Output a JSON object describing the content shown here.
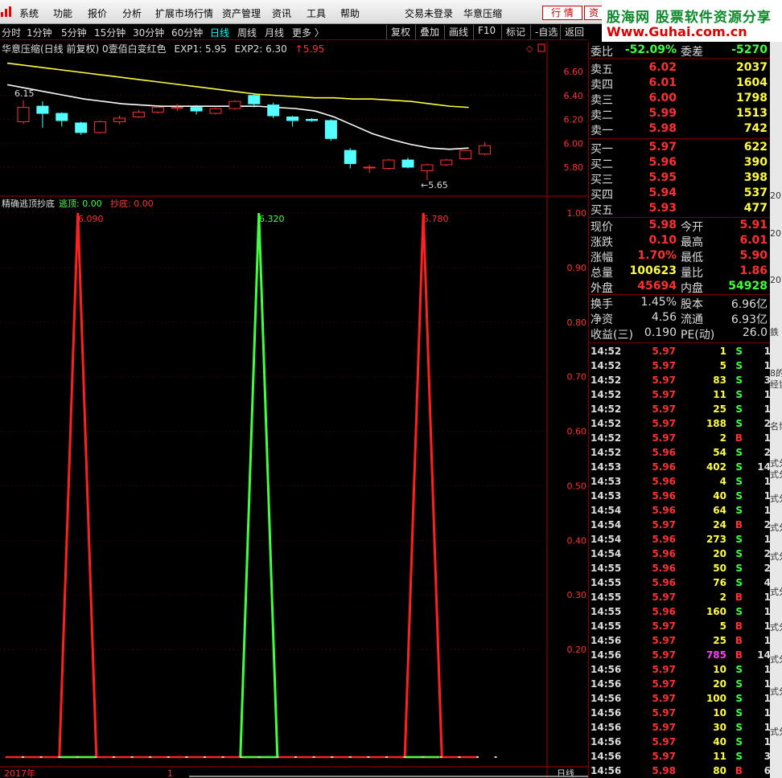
{
  "menubar": {
    "items": [
      "系统",
      "功能",
      "报价",
      "分析",
      "扩展市场行情",
      "资产管理",
      "资讯",
      "工具",
      "帮助"
    ],
    "login_status": "交易未登录",
    "app_name": "华意压缩",
    "btn_quote": "行 情",
    "btn_info": "资",
    "brand_line1": "股海网 股票软件资源分享",
    "brand_line2": "Www.Guhai.com.cn"
  },
  "toolbar": {
    "periods": [
      "分时",
      "1分钟",
      "5分钟",
      "15分钟",
      "30分钟",
      "60分钟",
      "日线",
      "周线",
      "月线",
      "更多 〉"
    ],
    "active_period": "日线",
    "actions": [
      "复权",
      "叠加",
      "画线",
      "F10",
      "标记",
      "-自选",
      "返回"
    ]
  },
  "price_panel": {
    "title": "华意压缩(日线 前复权)",
    "indicator": "0壹佰白变红色",
    "exp1": "EXP1: 5.95",
    "exp2": "EXP2: 6.30",
    "last_change": "↑5.95",
    "low_marker": "←5.65",
    "left_marker": "6.15",
    "y_ticks": [
      "6.60",
      "6.40",
      "6.20",
      "6.00",
      "5.80"
    ],
    "colors": {
      "up": "#ff3030",
      "down": "#54ffff",
      "ma1": "#ffffff",
      "ma2": "#ffff40"
    }
  },
  "indicator_panel": {
    "title": "精确逃顶抄底",
    "escape_label": "逃顶: 0.00",
    "bottom_label": "抄底: 0.00",
    "y_ticks": [
      "1.00",
      "0.90",
      "0.80",
      "0.70",
      "0.60",
      "0.50",
      "0.40",
      "0.30",
      "0.20"
    ],
    "peak_labels": [
      "6.090",
      "6.320",
      "5.780"
    ],
    "x_label": "2017年",
    "x_label2": "1",
    "period_label": "日线"
  },
  "chart_data": [
    {
      "type": "candlestick",
      "title": "华意压缩(日线 前复权)",
      "ylim": [
        5.6,
        6.7
      ],
      "candles": [
        {
          "o": 6.18,
          "c": 6.3,
          "h": 6.36,
          "l": 6.16
        },
        {
          "o": 6.31,
          "c": 6.25,
          "h": 6.35,
          "l": 6.13
        },
        {
          "o": 6.25,
          "c": 6.19,
          "h": 6.26,
          "l": 6.14
        },
        {
          "o": 6.17,
          "c": 6.09,
          "h": 6.18,
          "l": 6.07
        },
        {
          "o": 6.09,
          "c": 6.18,
          "h": 6.19,
          "l": 6.08
        },
        {
          "o": 6.18,
          "c": 6.21,
          "h": 6.23,
          "l": 6.16
        },
        {
          "o": 6.22,
          "c": 6.26,
          "h": 6.28,
          "l": 6.21
        },
        {
          "o": 6.26,
          "c": 6.3,
          "h": 6.31,
          "l": 6.25
        },
        {
          "o": 6.3,
          "c": 6.3,
          "h": 6.33,
          "l": 6.27
        },
        {
          "o": 6.3,
          "c": 6.27,
          "h": 6.32,
          "l": 6.24
        },
        {
          "o": 6.25,
          "c": 6.29,
          "h": 6.3,
          "l": 6.24
        },
        {
          "o": 6.29,
          "c": 6.35,
          "h": 6.36,
          "l": 6.28
        },
        {
          "o": 6.4,
          "c": 6.33,
          "h": 6.41,
          "l": 6.3
        },
        {
          "o": 6.32,
          "c": 6.23,
          "h": 6.34,
          "l": 6.21
        },
        {
          "o": 6.22,
          "c": 6.19,
          "h": 6.23,
          "l": 6.14
        },
        {
          "o": 6.2,
          "c": 6.19,
          "h": 6.21,
          "l": 6.18
        },
        {
          "o": 6.19,
          "c": 6.04,
          "h": 6.2,
          "l": 6.02
        },
        {
          "o": 5.94,
          "c": 5.83,
          "h": 5.96,
          "l": 5.79
        },
        {
          "o": 5.8,
          "c": 5.8,
          "h": 5.82,
          "l": 5.75
        },
        {
          "o": 5.79,
          "c": 5.86,
          "h": 5.87,
          "l": 5.78
        },
        {
          "o": 5.86,
          "c": 5.8,
          "h": 5.88,
          "l": 5.79
        },
        {
          "o": 5.77,
          "c": 5.82,
          "h": 5.83,
          "l": 5.69
        },
        {
          "o": 5.82,
          "c": 5.86,
          "h": 5.87,
          "l": 5.81
        },
        {
          "o": 5.87,
          "c": 5.94,
          "h": 5.94,
          "l": 5.86
        },
        {
          "o": 5.91,
          "c": 5.98,
          "h": 6.01,
          "l": 5.9
        }
      ],
      "ma_white": [
        6.49,
        6.46,
        6.43,
        6.4,
        6.37,
        6.35,
        6.33,
        6.32,
        6.31,
        6.31,
        6.31,
        6.31,
        6.31,
        6.31,
        6.3,
        6.29,
        6.27,
        6.22,
        6.15,
        6.08,
        6.03,
        5.99,
        5.96,
        5.95,
        5.96
      ],
      "ma_yellow": [
        6.67,
        6.65,
        6.63,
        6.61,
        6.59,
        6.57,
        6.55,
        6.53,
        6.51,
        6.49,
        6.47,
        6.45,
        6.43,
        6.41,
        6.4,
        6.39,
        6.38,
        6.38,
        6.37,
        6.37,
        6.36,
        6.35,
        6.33,
        6.31,
        6.3
      ]
    },
    {
      "type": "line",
      "title": "精确逃顶抄底",
      "ylim": [
        0,
        1.0
      ],
      "series": [
        {
          "name": "逃顶",
          "color": "#40ff40",
          "values": [
            0,
            0,
            0,
            0,
            0,
            0,
            0,
            0,
            0,
            0,
            0,
            0,
            0,
            1,
            0,
            0,
            0,
            0,
            0,
            0,
            0,
            0,
            0,
            0,
            0,
            0,
            0
          ]
        },
        {
          "name": "抄底",
          "color": "#ff2020",
          "values": [
            0,
            0,
            0,
            1,
            0,
            0,
            0,
            0,
            0,
            0,
            0,
            0,
            0,
            0,
            0,
            0,
            0,
            0,
            0,
            0,
            0,
            0,
            1,
            0,
            0,
            0,
            0
          ]
        }
      ]
    }
  ],
  "quote": {
    "weibi": {
      "label": "委比",
      "value": "-52.09%",
      "label2": "委差",
      "value2": "-5270"
    },
    "asks": [
      {
        "label": "卖五",
        "price": "6.02",
        "vol": "2037"
      },
      {
        "label": "卖四",
        "price": "6.01",
        "vol": "1604"
      },
      {
        "label": "卖三",
        "price": "6.00",
        "vol": "1798"
      },
      {
        "label": "卖二",
        "price": "5.99",
        "vol": "1513"
      },
      {
        "label": "卖一",
        "price": "5.98",
        "vol": "742"
      }
    ],
    "bids": [
      {
        "label": "买一",
        "price": "5.97",
        "vol": "622"
      },
      {
        "label": "买二",
        "price": "5.96",
        "vol": "390"
      },
      {
        "label": "买三",
        "price": "5.95",
        "vol": "398"
      },
      {
        "label": "买四",
        "price": "5.94",
        "vol": "537"
      },
      {
        "label": "买五",
        "price": "5.93",
        "vol": "477"
      }
    ],
    "stats": [
      {
        "l1": "现价",
        "v1": "5.98",
        "c1": "#ff3030",
        "l2": "今开",
        "v2": "5.91",
        "c2": "#ff3030"
      },
      {
        "l1": "涨跌",
        "v1": "0.10",
        "c1": "#ff3030",
        "l2": "最高",
        "v2": "6.01",
        "c2": "#ff3030"
      },
      {
        "l1": "涨幅",
        "v1": "1.70%",
        "c1": "#ff3030",
        "l2": "最低",
        "v2": "5.90",
        "c2": "#ff3030"
      },
      {
        "l1": "总量",
        "v1": "100623",
        "c1": "#ffff40",
        "l2": "量比",
        "v2": "1.86",
        "c2": "#ff3030"
      },
      {
        "l1": "外盘",
        "v1": "45694",
        "c1": "#ff3030",
        "l2": "内盘",
        "v2": "54928",
        "c2": "#40ff40"
      }
    ],
    "stats2": [
      {
        "l1": "换手",
        "v1": "1.45%",
        "l2": "股本",
        "v2": "6.96亿"
      },
      {
        "l1": "净资",
        "v1": "4.56",
        "l2": "流通",
        "v2": "6.93亿"
      },
      {
        "l1": "收益(三)",
        "v1": "0.190",
        "l2": "PE(动)",
        "v2": "26.0"
      }
    ],
    "ticks": [
      {
        "t": "14:52",
        "p": "5.97",
        "v": "1",
        "bs": "S",
        "n": "1"
      },
      {
        "t": "14:52",
        "p": "5.97",
        "v": "5",
        "bs": "S",
        "n": "1"
      },
      {
        "t": "14:52",
        "p": "5.97",
        "v": "83",
        "bs": "S",
        "n": "3"
      },
      {
        "t": "14:52",
        "p": "5.97",
        "v": "11",
        "bs": "S",
        "n": "1"
      },
      {
        "t": "14:52",
        "p": "5.97",
        "v": "25",
        "bs": "S",
        "n": "1"
      },
      {
        "t": "14:52",
        "p": "5.97",
        "v": "188",
        "bs": "S",
        "n": "2"
      },
      {
        "t": "14:52",
        "p": "5.97",
        "v": "2",
        "bs": "B",
        "n": "1"
      },
      {
        "t": "14:52",
        "p": "5.96",
        "v": "54",
        "bs": "S",
        "n": "2"
      },
      {
        "t": "14:53",
        "p": "5.96",
        "v": "402",
        "bs": "S",
        "n": "14"
      },
      {
        "t": "14:53",
        "p": "5.96",
        "v": "4",
        "bs": "S",
        "n": "1"
      },
      {
        "t": "14:53",
        "p": "5.96",
        "v": "40",
        "bs": "S",
        "n": "1"
      },
      {
        "t": "14:54",
        "p": "5.96",
        "v": "64",
        "bs": "S",
        "n": "1"
      },
      {
        "t": "14:54",
        "p": "5.97",
        "v": "24",
        "bs": "B",
        "n": "2"
      },
      {
        "t": "14:54",
        "p": "5.96",
        "v": "273",
        "bs": "S",
        "n": "1"
      },
      {
        "t": "14:54",
        "p": "5.96",
        "v": "20",
        "bs": "S",
        "n": "2"
      },
      {
        "t": "14:55",
        "p": "5.96",
        "v": "50",
        "bs": "S",
        "n": "2"
      },
      {
        "t": "14:55",
        "p": "5.96",
        "v": "76",
        "bs": "S",
        "n": "4"
      },
      {
        "t": "14:55",
        "p": "5.97",
        "v": "2",
        "bs": "B",
        "n": "1"
      },
      {
        "t": "14:55",
        "p": "5.96",
        "v": "160",
        "bs": "S",
        "n": "1"
      },
      {
        "t": "14:55",
        "p": "5.97",
        "v": "5",
        "bs": "B",
        "n": "1"
      },
      {
        "t": "14:56",
        "p": "5.97",
        "v": "25",
        "bs": "B",
        "n": "1"
      },
      {
        "t": "14:56",
        "p": "5.97",
        "v": "785",
        "bs": "B",
        "n": "14"
      },
      {
        "t": "14:56",
        "p": "5.97",
        "v": "10",
        "bs": "S",
        "n": "1"
      },
      {
        "t": "14:56",
        "p": "5.97",
        "v": "20",
        "bs": "S",
        "n": "1"
      },
      {
        "t": "14:56",
        "p": "5.97",
        "v": "100",
        "bs": "S",
        "n": "1"
      },
      {
        "t": "14:56",
        "p": "5.97",
        "v": "10",
        "bs": "S",
        "n": "1"
      },
      {
        "t": "14:56",
        "p": "5.97",
        "v": "30",
        "bs": "S",
        "n": "1"
      },
      {
        "t": "14:56",
        "p": "5.97",
        "v": "40",
        "bs": "S",
        "n": "1"
      },
      {
        "t": "14:56",
        "p": "5.97",
        "v": "11",
        "bs": "S",
        "n": "3"
      },
      {
        "t": "14:56",
        "p": "5.98",
        "v": "80",
        "bs": "B",
        "n": "6"
      }
    ]
  },
  "right_strip": [
    "20",
    "20",
    "20",
    "鉄",
    "8的",
    "经协",
    "名博",
    "式分",
    "式分",
    "式分",
    "式分",
    "式分",
    "式分",
    "式分",
    "式分",
    "式分",
    "式分"
  ]
}
